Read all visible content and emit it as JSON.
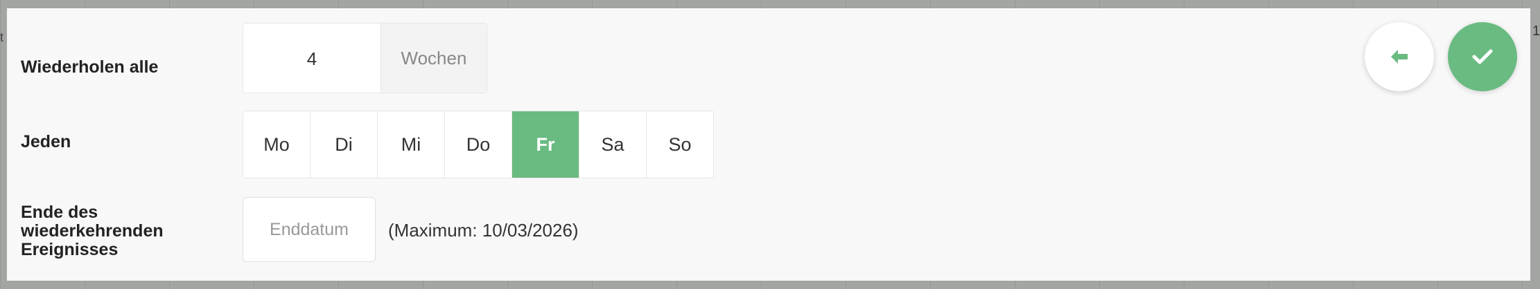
{
  "background": {
    "edge_left": "t",
    "edge_right": "1"
  },
  "repeat": {
    "label": "Wiederholen alle",
    "interval_value": "4",
    "unit": "Wochen"
  },
  "days": {
    "label": "Jeden",
    "items": [
      {
        "label": "Mo",
        "selected": false
      },
      {
        "label": "Di",
        "selected": false
      },
      {
        "label": "Mi",
        "selected": false
      },
      {
        "label": "Do",
        "selected": false
      },
      {
        "label": "Fr",
        "selected": true
      },
      {
        "label": "Sa",
        "selected": false
      },
      {
        "label": "So",
        "selected": false
      }
    ]
  },
  "end": {
    "label": "Ende des wiederkehrenden Ereignisses",
    "placeholder": "Enddatum",
    "max_note": "(Maximum: 10/03/2026)"
  },
  "actions": {
    "back_icon": "arrow-left-icon",
    "confirm_icon": "check-icon"
  },
  "colors": {
    "accent": "#6abb82",
    "modal_bg": "#f8f8f8",
    "overlay": "#a3a5a3"
  }
}
